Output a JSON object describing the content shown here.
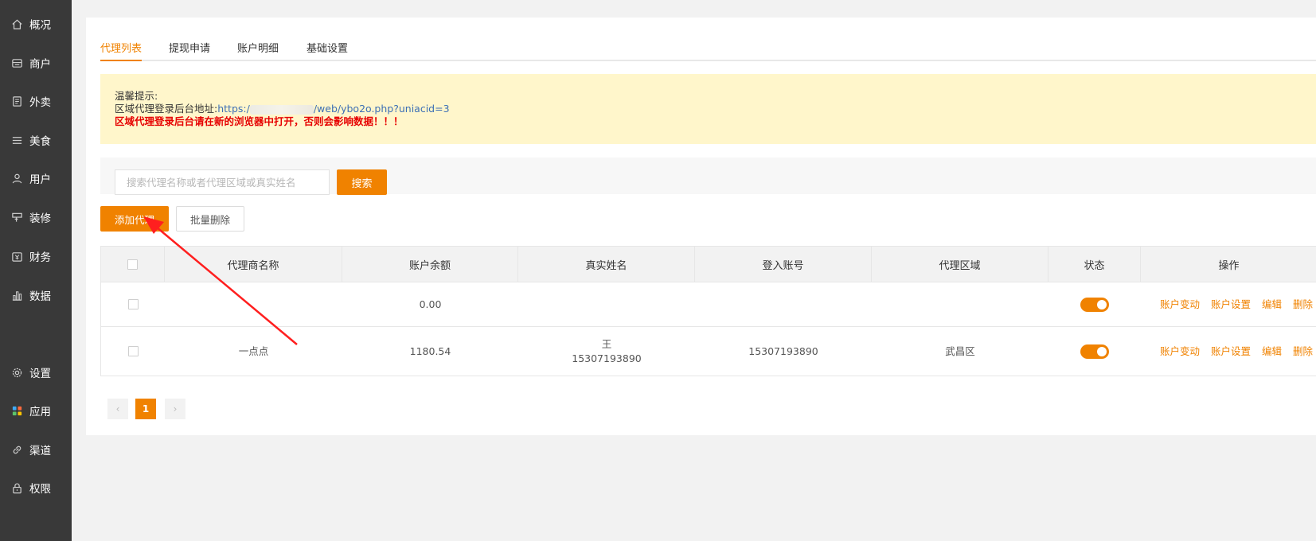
{
  "sidebar": {
    "items": [
      {
        "label": "概况",
        "icon": "home-icon"
      },
      {
        "label": "商户",
        "icon": "store-icon"
      },
      {
        "label": "外卖",
        "icon": "document-icon"
      },
      {
        "label": "美食",
        "icon": "menu-icon"
      },
      {
        "label": "用户",
        "icon": "user-icon"
      },
      {
        "label": "装修",
        "icon": "brush-icon"
      },
      {
        "label": "财务",
        "icon": "wallet-icon"
      },
      {
        "label": "数据",
        "icon": "bar-chart-icon"
      },
      {
        "label": "设置",
        "icon": "gear-icon"
      },
      {
        "label": "应用",
        "icon": "apps-icon"
      },
      {
        "label": "渠道",
        "icon": "link-icon"
      },
      {
        "label": "权限",
        "icon": "lock-icon"
      }
    ]
  },
  "tabs": [
    {
      "label": "代理列表",
      "active": true
    },
    {
      "label": "提现申请",
      "active": false
    },
    {
      "label": "账户明细",
      "active": false
    },
    {
      "label": "基础设置",
      "active": false
    }
  ],
  "notice": {
    "title": "温馨提示:",
    "address_label": "区域代理登录后台地址:",
    "url_prefix": "https:/",
    "url_suffix": "/web/ybo2o.php?uniacid=3",
    "warning": "区域代理登录后台请在新的浏览器中打开，否则会影响数据！！！"
  },
  "search": {
    "placeholder": "搜索代理名称或者代理区域或真实姓名",
    "value": "",
    "button": "搜索"
  },
  "actions": {
    "add": "添加代理",
    "batch_delete": "批量删除"
  },
  "table": {
    "headers": [
      "代理商名称",
      "账户余额",
      "真实姓名",
      "登入账号",
      "代理区域",
      "状态",
      "操作"
    ],
    "operations": [
      "账户变动",
      "账户设置",
      "编辑",
      "删除"
    ],
    "rows": [
      {
        "name": "",
        "balance": "0.00",
        "real_name": "",
        "real_name_phone": "",
        "account": "",
        "region": "",
        "status_on": true
      },
      {
        "name": "一点点",
        "balance": "1180.54",
        "real_name": "王",
        "real_name_phone": "15307193890",
        "account": "15307193890",
        "region": "武昌区",
        "status_on": true
      }
    ]
  },
  "pagination": {
    "prev": "‹",
    "current": "1",
    "next": "›"
  },
  "colors": {
    "accent": "#f08200",
    "sidebar_bg": "#393939",
    "notice_bg": "#fff6cb",
    "warning": "#e60000"
  }
}
